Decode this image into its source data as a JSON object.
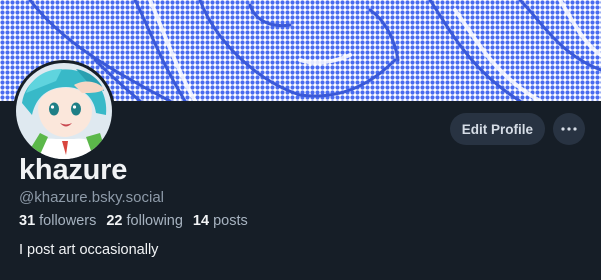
{
  "banner": {
    "pattern_color": "#4a6cf0",
    "background": "#ffffff"
  },
  "profile": {
    "display_name": "khazure",
    "handle": "@khazure.bsky.social",
    "bio": "I post art occasionally"
  },
  "stats": [
    {
      "count": "31",
      "label": "followers"
    },
    {
      "count": "22",
      "label": "following"
    },
    {
      "count": "14",
      "label": "posts"
    }
  ],
  "actions": {
    "edit_label": "Edit Profile",
    "more_icon": "ellipsis-icon"
  },
  "colors": {
    "background": "#161e27",
    "button_bg": "#283342",
    "text_primary": "#f1f3f5",
    "text_secondary": "#8d9aa8"
  }
}
